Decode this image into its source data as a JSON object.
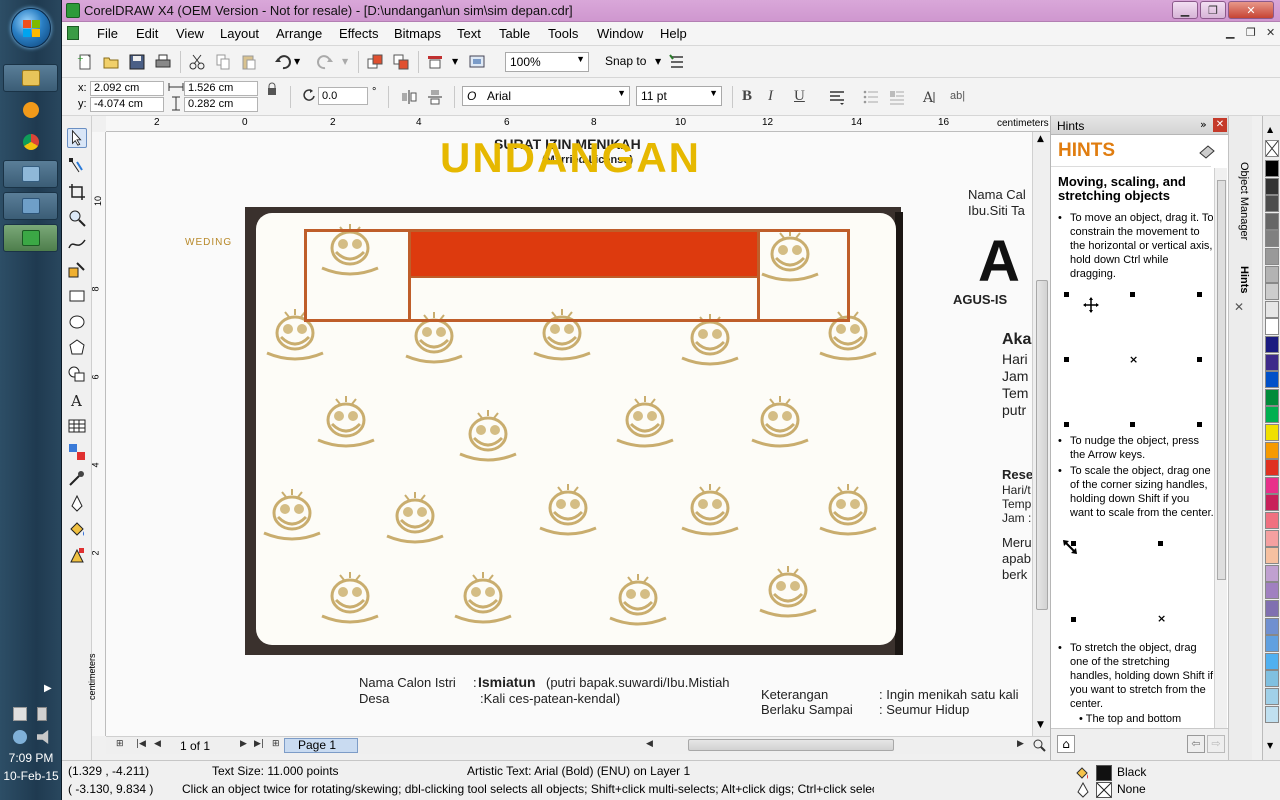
{
  "taskbar": {
    "clock_time": "7:09 PM",
    "clock_date": "10-Feb-15"
  },
  "window": {
    "title": "CorelDRAW X4 (OEM Version - Not for resale) - [D:\\undangan\\un sim\\sim depan.cdr]"
  },
  "menu": {
    "items": [
      "File",
      "Edit",
      "View",
      "Layout",
      "Arrange",
      "Effects",
      "Bitmaps",
      "Text",
      "Table",
      "Tools",
      "Window",
      "Help"
    ]
  },
  "std_toolbar": {
    "zoom": "100%",
    "snap": "Snap to"
  },
  "prop_bar": {
    "x_label": "x:",
    "x_value": "2.092 cm",
    "y_label": "y:",
    "y_value": "-4.074 cm",
    "w_value": "1.526 cm",
    "h_value": "0.282 cm",
    "rotation": "0.0",
    "rotation_unit": "°",
    "font_name": "Arial",
    "font_size": "11 pt",
    "bold": "B",
    "italic": "I",
    "underline": "U",
    "abl": "ab|"
  },
  "rulers": {
    "h_ticks": [
      "2",
      "0",
      "2",
      "4",
      "6",
      "8",
      "10",
      "12",
      "14",
      "16"
    ],
    "h_unit": "centimeters",
    "v_ticks": [
      "10",
      "8",
      "6",
      "4",
      "2"
    ],
    "v_unit": "centimeters"
  },
  "document": {
    "title": "UNDANGAN",
    "title_behind": "SURAT IZIN MENIKAH",
    "title_behind_2": "(Married License)",
    "weding": "WEDING",
    "right": {
      "nama_calon": "Nama Cal",
      "ibu": "Ibu.Siti Ta",
      "big_letter": "A",
      "agus": "AGUS-IS",
      "aka": "Aka",
      "hari": "Hari",
      "jam": "Jam",
      "tem": "Tem",
      "putr": "putr",
      "rese": "Rese",
      "hari_t": "Hari/t",
      "temp": "Temp",
      "jam2": "Jam :",
      "meru": "Meru",
      "apab": "apab",
      "berk": "berk"
    },
    "bottom": {
      "nama_calon_istri_label": "Nama Calon Istri",
      "colon1": ":",
      "istri_name": "Ismiatun",
      "istri_parents": "(putri bapak.suwardi/Ibu.Mistiah",
      "desa_label": "Desa",
      "desa_value": ":Kali ces-patean-kendal)",
      "keterangan_label": "Keterangan",
      "keterangan_value": ": Ingin menikah satu kali",
      "berlaku_label": "Berlaku Sampai",
      "berlaku_value": ": Seumur Hidup"
    }
  },
  "page_nav": {
    "counter": "1 of 1",
    "tab": "Page 1"
  },
  "docker": {
    "title": "Hints",
    "heading": "HINTS",
    "subtitle": "Moving, scaling, and stretching objects",
    "bullets": [
      "To move an object, drag it. To constrain the movement to the horizontal or vertical axis, hold down Ctrl while dragging.",
      "To nudge the object, press the Arrow keys.",
      "To scale the object, drag one of the corner sizing handles, holding down Shift if you want to scale from the center.",
      "To stretch the object, drag one of the stretching handles, holding down Shift if you want to stretch from the center."
    ],
    "sub_bullet": "The top and bottom",
    "side_tabs": [
      "Object Manager",
      "Hints"
    ]
  },
  "palette": {
    "colors": [
      "#000000",
      "#333333",
      "#4d4d4d",
      "#666666",
      "#808080",
      "#999999",
      "#b3b3b3",
      "#cccccc",
      "#e6e6e6",
      "#ffffff",
      "#1a1a80",
      "#3d2a8a",
      "#0050c8",
      "#008b3a",
      "#00b050",
      "#f0e000",
      "#f59a00",
      "#e03020",
      "#e8308a",
      "#c8205a",
      "#f07080",
      "#f4a0a0",
      "#f6c0a0",
      "#c0a0d0",
      "#a080c0",
      "#8070b0",
      "#7090d0",
      "#60a0e0",
      "#50b0f0",
      "#80c0e0",
      "#a0d0e8",
      "#c0e0f0"
    ]
  },
  "status": {
    "coords_1": "(1.329 , -4.211)",
    "text_size": "Text Size: 11.000 points",
    "object_info": "Artistic Text: Arial (Bold) (ENU) on Layer 1",
    "coords_2": "( -3.130, 9.834 )",
    "hint": "Click an object twice for rotating/skewing; dbl-clicking tool selects all objects; Shift+click multi-selects; Alt+click digs; Ctrl+click selects in a group",
    "fill_name": "Black",
    "outline_name": "None"
  }
}
